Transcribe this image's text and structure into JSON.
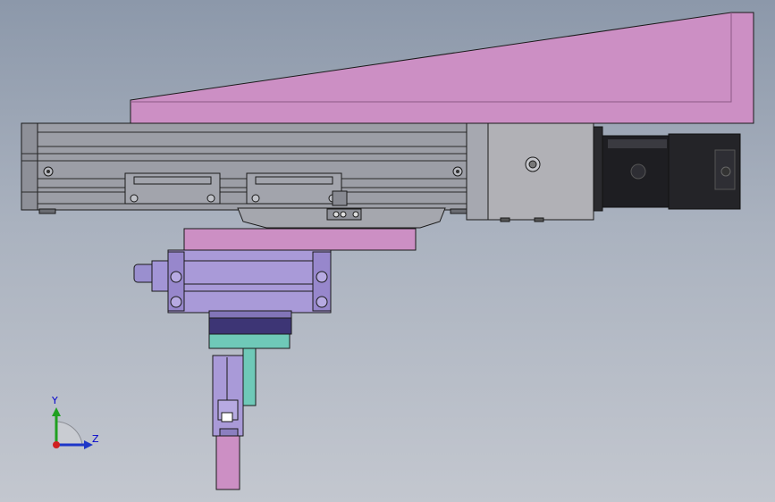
{
  "viewport": {
    "background_top": "#8c98aa",
    "background_bottom": "#c3c7cf"
  },
  "colors": {
    "pink_part": "#cc8fc4",
    "rail_body": "#9c9ea6",
    "motor_block": "#b1b1b6",
    "motor_housing": "#1e1e22",
    "cylinder_body": "#a99ad8",
    "gripper_jaw": "#6fc9b8",
    "outline": "#1a1a1a"
  },
  "triad": {
    "y_label": "Y",
    "z_label": "Z",
    "y_color": "#20a020",
    "z_color": "#1d36c8",
    "x_color": "#d02020"
  }
}
